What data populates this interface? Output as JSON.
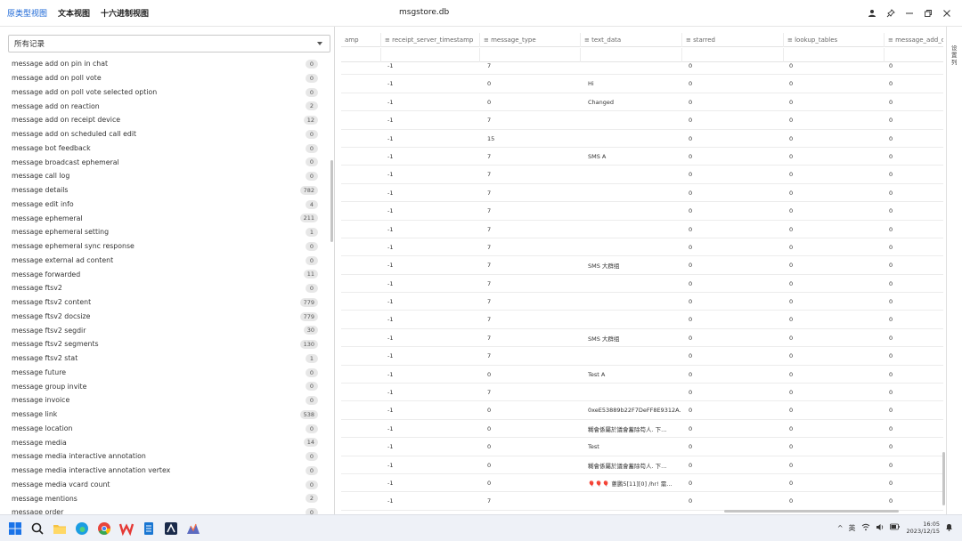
{
  "titlebar": {
    "tabs": [
      "原类型视图",
      "文本视图",
      "十六进制视图"
    ],
    "active_tab": 0,
    "title": "msgstore.db"
  },
  "left_panel": {
    "select_value": "所有记录",
    "items": [
      {
        "label": "message add on pin in chat",
        "count": "0"
      },
      {
        "label": "message add on poll vote",
        "count": "0"
      },
      {
        "label": "message add on poll vote selected option",
        "count": "0"
      },
      {
        "label": "message add on reaction",
        "count": "2"
      },
      {
        "label": "message add on receipt device",
        "count": "12"
      },
      {
        "label": "message add on scheduled call edit",
        "count": "0"
      },
      {
        "label": "message bot feedback",
        "count": "0"
      },
      {
        "label": "message broadcast ephemeral",
        "count": "0"
      },
      {
        "label": "message call log",
        "count": "0"
      },
      {
        "label": "message details",
        "count": "782"
      },
      {
        "label": "message edit info",
        "count": "4"
      },
      {
        "label": "message ephemeral",
        "count": "211"
      },
      {
        "label": "message ephemeral setting",
        "count": "1"
      },
      {
        "label": "message ephemeral sync response",
        "count": "0"
      },
      {
        "label": "message external ad content",
        "count": "0"
      },
      {
        "label": "message forwarded",
        "count": "11"
      },
      {
        "label": "message ftsv2",
        "count": "0"
      },
      {
        "label": "message ftsv2 content",
        "count": "779"
      },
      {
        "label": "message ftsv2 docsize",
        "count": "779"
      },
      {
        "label": "message ftsv2 segdir",
        "count": "30"
      },
      {
        "label": "message ftsv2 segments",
        "count": "130"
      },
      {
        "label": "message ftsv2 stat",
        "count": "1"
      },
      {
        "label": "message future",
        "count": "0"
      },
      {
        "label": "message group invite",
        "count": "0"
      },
      {
        "label": "message invoice",
        "count": "0"
      },
      {
        "label": "message link",
        "count": "538"
      },
      {
        "label": "message location",
        "count": "0"
      },
      {
        "label": "message media",
        "count": "14"
      },
      {
        "label": "message media interactive annotation",
        "count": "0"
      },
      {
        "label": "message media interactive annotation vertex",
        "count": "0"
      },
      {
        "label": "message media vcard count",
        "count": "0"
      },
      {
        "label": "message mentions",
        "count": "2"
      },
      {
        "label": "message order",
        "count": "0"
      }
    ]
  },
  "grid": {
    "columns": [
      "amp",
      "≡ receipt_server_timestamp",
      "≡ message_type",
      "≡ text_data",
      "≡ starred",
      "≡ lookup_tables",
      "≡ message_add_on"
    ],
    "rows": [
      [
        "-1",
        "7",
        "",
        "0",
        "0",
        "0"
      ],
      [
        "-1",
        "0",
        "Hi",
        "0",
        "0",
        "0"
      ],
      [
        "-1",
        "0",
        "Changed",
        "0",
        "0",
        "0"
      ],
      [
        "-1",
        "7",
        "",
        "0",
        "0",
        "0"
      ],
      [
        "-1",
        "15",
        "",
        "0",
        "0",
        "0"
      ],
      [
        "-1",
        "7",
        "SMS A",
        "0",
        "0",
        "0"
      ],
      [
        "-1",
        "7",
        "",
        "0",
        "0",
        "0"
      ],
      [
        "-1",
        "7",
        "",
        "0",
        "0",
        "0"
      ],
      [
        "-1",
        "7",
        "",
        "0",
        "0",
        "0"
      ],
      [
        "-1",
        "7",
        "",
        "0",
        "0",
        "0"
      ],
      [
        "-1",
        "7",
        "",
        "0",
        "0",
        "0"
      ],
      [
        "-1",
        "7",
        "SMS 大群组",
        "0",
        "0",
        "0"
      ],
      [
        "-1",
        "7",
        "",
        "0",
        "0",
        "0"
      ],
      [
        "-1",
        "7",
        "",
        "0",
        "0",
        "0"
      ],
      [
        "-1",
        "7",
        "",
        "0",
        "0",
        "0"
      ],
      [
        "-1",
        "7",
        "SMS 大群组",
        "0",
        "0",
        "0"
      ],
      [
        "-1",
        "7",
        "",
        "0",
        "0",
        "0"
      ],
      [
        "-1",
        "0",
        "Test A",
        "0",
        "0",
        "0"
      ],
      [
        "-1",
        "7",
        "",
        "0",
        "0",
        "0"
      ],
      [
        "-1",
        "0",
        "0xeE53889b22F7DeFF8E9312A...",
        "0",
        "0",
        "0"
      ],
      [
        "-1",
        "0",
        "糊會係屬於議會蓄除苟人. 下...",
        "0",
        "0",
        "0"
      ],
      [
        "-1",
        "0",
        "Test",
        "0",
        "0",
        "0"
      ],
      [
        "-1",
        "0",
        "糊會係屬於議會蓄除苟人. 下...",
        "0",
        "0",
        "0"
      ],
      [
        "-1",
        "0",
        "🎈🎈🎈 蔥鹏5[11][0] /hr! 需...",
        "0",
        "0",
        "0"
      ],
      [
        "-1",
        "7",
        "",
        "0",
        "0",
        "0"
      ]
    ]
  },
  "right_rail": {
    "label": "设置列"
  },
  "taskbar": {
    "tray_items": [
      "^",
      "英"
    ],
    "time": "16:05",
    "date": "2023/12/15"
  }
}
